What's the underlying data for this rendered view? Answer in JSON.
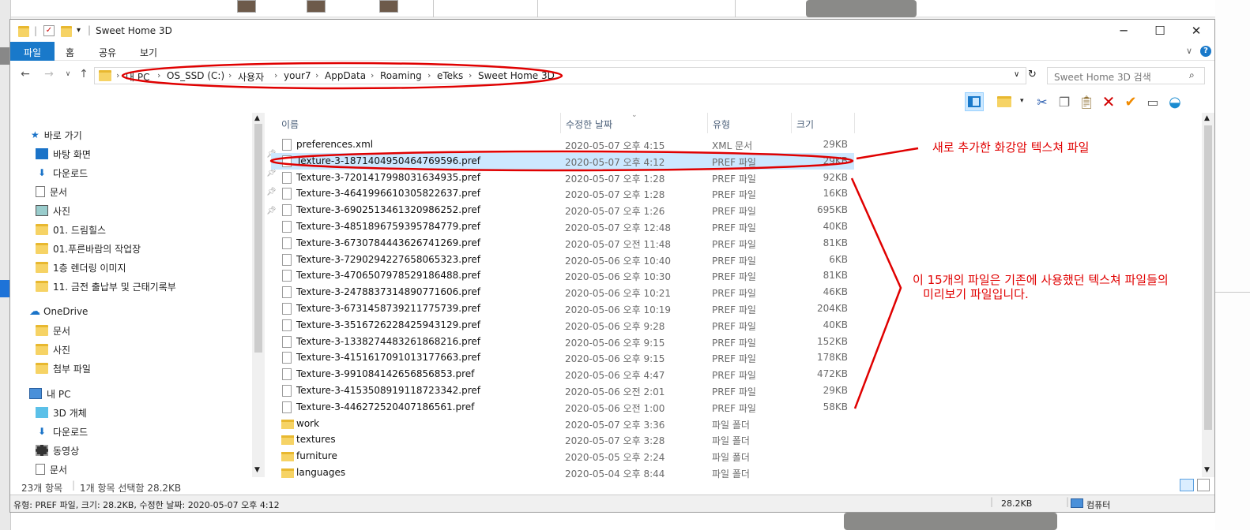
{
  "window": {
    "title": "Sweet Home 3D"
  },
  "ribbon": {
    "tabs": [
      "파일",
      "홈",
      "공유",
      "보기"
    ]
  },
  "address": {
    "crumbs": [
      "내 PC",
      "OS_SSD (C:)",
      "사용자",
      "your7",
      "AppData",
      "Roaming",
      "eTeks",
      "Sweet Home 3D"
    ],
    "search_placeholder": "Sweet Home 3D 검색"
  },
  "nav": {
    "quick_access": "바로 가기",
    "quick_items": [
      "바탕 화면",
      "다운로드",
      "문서",
      "사진",
      "01. 드림힐스",
      "01.푸른바람의 작업장",
      "1층 렌더링 이미지",
      "11. 금전 출납부 및 근태기록부"
    ],
    "onedrive": "OneDrive",
    "onedrive_items": [
      "문서",
      "사진",
      "첨부 파일"
    ],
    "thispc": "내 PC",
    "thispc_items": [
      "3D 개체",
      "다운로드",
      "동영상",
      "문서"
    ]
  },
  "columns": {
    "name": "이름",
    "date": "수정한 날짜",
    "type": "유형",
    "size": "크기"
  },
  "files": [
    {
      "name": "preferences.xml",
      "date": "2020-05-07 오후 4:15",
      "type": "XML 문서",
      "size": "29KB",
      "kind": "file"
    },
    {
      "name": "Texture-3-1871404950464769596.pref",
      "date": "2020-05-07 오후 4:12",
      "type": "PREF 파일",
      "size": "29KB",
      "kind": "file"
    },
    {
      "name": "Texture-3-7201417998031634935.pref",
      "date": "2020-05-07 오후 1:28",
      "type": "PREF 파일",
      "size": "92KB",
      "kind": "file"
    },
    {
      "name": "Texture-3-4641996610305822637.pref",
      "date": "2020-05-07 오후 1:28",
      "type": "PREF 파일",
      "size": "16KB",
      "kind": "file"
    },
    {
      "name": "Texture-3-6902513461320986252.pref",
      "date": "2020-05-07 오후 1:26",
      "type": "PREF 파일",
      "size": "695KB",
      "kind": "file"
    },
    {
      "name": "Texture-3-4851896759395784779.pref",
      "date": "2020-05-07 오후 12:48",
      "type": "PREF 파일",
      "size": "40KB",
      "kind": "file"
    },
    {
      "name": "Texture-3-6730784443626741269.pref",
      "date": "2020-05-07 오전 11:48",
      "type": "PREF 파일",
      "size": "81KB",
      "kind": "file"
    },
    {
      "name": "Texture-3-7290294227658065323.pref",
      "date": "2020-05-06 오후 10:40",
      "type": "PREF 파일",
      "size": "6KB",
      "kind": "file"
    },
    {
      "name": "Texture-3-4706507978529186488.pref",
      "date": "2020-05-06 오후 10:30",
      "type": "PREF 파일",
      "size": "81KB",
      "kind": "file"
    },
    {
      "name": "Texture-3-2478837314890771606.pref",
      "date": "2020-05-06 오후 10:21",
      "type": "PREF 파일",
      "size": "46KB",
      "kind": "file"
    },
    {
      "name": "Texture-3-6731458739211775739.pref",
      "date": "2020-05-06 오후 10:19",
      "type": "PREF 파일",
      "size": "204KB",
      "kind": "file"
    },
    {
      "name": "Texture-3-3516726228425943129.pref",
      "date": "2020-05-06 오후 9:28",
      "type": "PREF 파일",
      "size": "40KB",
      "kind": "file"
    },
    {
      "name": "Texture-3-1338274483261868216.pref",
      "date": "2020-05-06 오후 9:15",
      "type": "PREF 파일",
      "size": "152KB",
      "kind": "file"
    },
    {
      "name": "Texture-3-4151617091013177663.pref",
      "date": "2020-05-06 오후 9:15",
      "type": "PREF 파일",
      "size": "178KB",
      "kind": "file"
    },
    {
      "name": "Texture-3-991084142656856853.pref",
      "date": "2020-05-06 오후 4:47",
      "type": "PREF 파일",
      "size": "472KB",
      "kind": "file"
    },
    {
      "name": "Texture-3-4153508919118723342.pref",
      "date": "2020-05-06 오전 2:01",
      "type": "PREF 파일",
      "size": "29KB",
      "kind": "file"
    },
    {
      "name": "Texture-3-446272520407186561.pref",
      "date": "2020-05-06 오전 1:00",
      "type": "PREF 파일",
      "size": "58KB",
      "kind": "file"
    },
    {
      "name": "work",
      "date": "2020-05-07 오후 3:36",
      "type": "파일 폴더",
      "size": "",
      "kind": "folder"
    },
    {
      "name": "textures",
      "date": "2020-05-07 오후 3:28",
      "type": "파일 폴더",
      "size": "",
      "kind": "folder"
    },
    {
      "name": "furniture",
      "date": "2020-05-05 오후 2:24",
      "type": "파일 폴더",
      "size": "",
      "kind": "folder"
    },
    {
      "name": "languages",
      "date": "2020-05-04 오후 8:44",
      "type": "파일 폴더",
      "size": "",
      "kind": "folder"
    }
  ],
  "status": {
    "count": "23개 항목",
    "selected": "1개 항목 선택함 28.2KB"
  },
  "details": {
    "text": "유형: PREF 파일, 크기: 28.2KB, 수정한 날짜: 2020-05-07 오후 4:12",
    "size": "28.2KB",
    "computer": "컴퓨터"
  },
  "annotations": {
    "new_file": "새로 추가한 화강암 텍스쳐 파일",
    "existing_line1": "이 15개의 파일은 기존에 사용했던 텍스쳐 파일들의",
    "existing_line2": "미리보기 파일입니다.",
    "color": "#e00000"
  }
}
